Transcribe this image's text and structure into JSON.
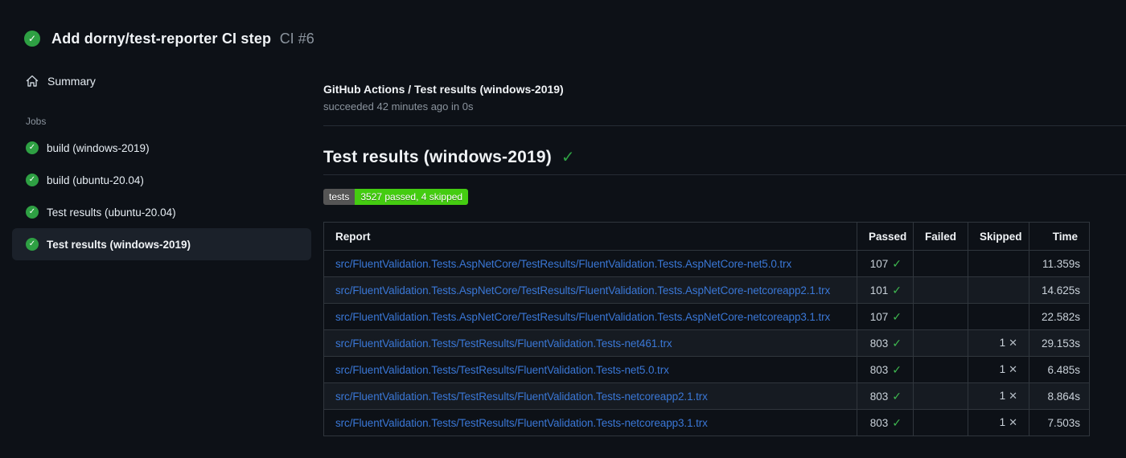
{
  "header": {
    "title": "Add dorny/test-reporter CI step",
    "run_number": "CI #6",
    "status_icon": "check-circle-icon",
    "check_glyph": "✓"
  },
  "sidebar": {
    "summary_label": "Summary",
    "jobs_section_label": "Jobs",
    "jobs": [
      {
        "label": "build (windows-2019)",
        "status": "success",
        "selected": false
      },
      {
        "label": "build (ubuntu-20.04)",
        "status": "success",
        "selected": false
      },
      {
        "label": "Test results (ubuntu-20.04)",
        "status": "success",
        "selected": false
      },
      {
        "label": "Test results (windows-2019)",
        "status": "success",
        "selected": true
      }
    ]
  },
  "main": {
    "check_header": {
      "title": "GitHub Actions / Test results (windows-2019)",
      "status_line": "succeeded 42 minutes ago in 0s"
    },
    "section": {
      "heading": "Test results (windows-2019)",
      "check_glyph": "✓"
    },
    "badge": {
      "label": "tests",
      "value": "3527 passed, 4 skipped",
      "label_bg": "#555555",
      "value_bg": "#44cc11"
    },
    "table": {
      "columns": [
        "Report",
        "Passed",
        "Failed",
        "Skipped",
        "Time"
      ],
      "glyphs": {
        "passed": "✓",
        "skipped": "✕"
      },
      "rows": [
        {
          "report": "src/FluentValidation.Tests.AspNetCore/TestResults/FluentValidation.Tests.AspNetCore-net5.0.trx",
          "passed": "107",
          "failed": "",
          "skipped": "",
          "time": "11.359s"
        },
        {
          "report": "src/FluentValidation.Tests.AspNetCore/TestResults/FluentValidation.Tests.AspNetCore-netcoreapp2.1.trx",
          "passed": "101",
          "failed": "",
          "skipped": "",
          "time": "14.625s"
        },
        {
          "report": "src/FluentValidation.Tests.AspNetCore/TestResults/FluentValidation.Tests.AspNetCore-netcoreapp3.1.trx",
          "passed": "107",
          "failed": "",
          "skipped": "",
          "time": "22.582s"
        },
        {
          "report": "src/FluentValidation.Tests/TestResults/FluentValidation.Tests-net461.trx",
          "passed": "803",
          "failed": "",
          "skipped": "1",
          "time": "29.153s"
        },
        {
          "report": "src/FluentValidation.Tests/TestResults/FluentValidation.Tests-net5.0.trx",
          "passed": "803",
          "failed": "",
          "skipped": "1",
          "time": "6.485s"
        },
        {
          "report": "src/FluentValidation.Tests/TestResults/FluentValidation.Tests-netcoreapp2.1.trx",
          "passed": "803",
          "failed": "",
          "skipped": "1",
          "time": "8.864s"
        },
        {
          "report": "src/FluentValidation.Tests/TestResults/FluentValidation.Tests-netcoreapp3.1.trx",
          "passed": "803",
          "failed": "",
          "skipped": "1",
          "time": "7.503s"
        }
      ]
    }
  },
  "colors": {
    "background": "#0d1117",
    "success_green": "#2ea043",
    "check_green": "#3fb950",
    "link_blue": "#3a77d6",
    "muted_text": "#8b949e",
    "table_border": "#30363d",
    "row_alt": "#161b22",
    "selected_item_bg": "#1b212a"
  }
}
